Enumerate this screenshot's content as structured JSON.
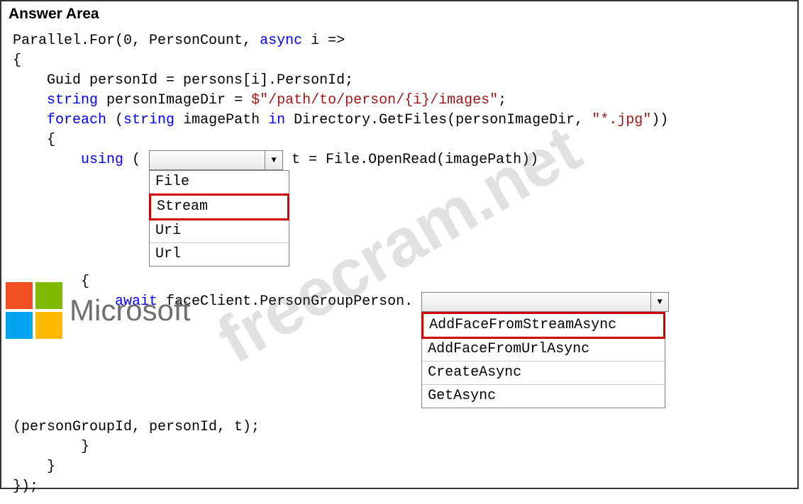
{
  "title": "Answer Area",
  "watermark": "freecram.net",
  "logo_text": "Microsoft",
  "code": {
    "line1_a": "Parallel.For(0, PersonCount, ",
    "line1_kw": "async",
    "line1_b": " i =>",
    "line2": "{",
    "line3_a": "    Guid personId = persons[i].PersonId;",
    "line4_kw": "    string",
    "line4_b": " personImageDir = ",
    "line4_str": "$\"/path/to/person/{i}/images\"",
    "line4_c": ";",
    "line5_kw1": "    foreach",
    "line5_a": " (",
    "line5_kw2": "string",
    "line5_b": " imagePath ",
    "line5_kw3": "in",
    "line5_c": " Directory.GetFiles(personImageDir, ",
    "line5_str": "\"*.jpg\"",
    "line5_d": "))",
    "line6": "    {",
    "line7_kw": "        using",
    "line7_a": " ( ",
    "line7_b": " t = File.OpenRead(imagePath))",
    "line8": "        {",
    "line9_kw": "            await",
    "line9_a": " faceClient.PersonGroupPerson. ",
    "line11": "(personGroupId, personId, t);",
    "line12": "        }",
    "line13": "    }",
    "line14": "});"
  },
  "combo1": {
    "options": [
      "File",
      "Stream",
      "Uri",
      "Url"
    ],
    "selected": "Stream"
  },
  "combo2": {
    "options": [
      "AddFaceFromStreamAsync",
      "AddFaceFromUrlAsync",
      "CreateAsync",
      "GetAsync"
    ],
    "selected": "AddFaceFromStreamAsync"
  }
}
